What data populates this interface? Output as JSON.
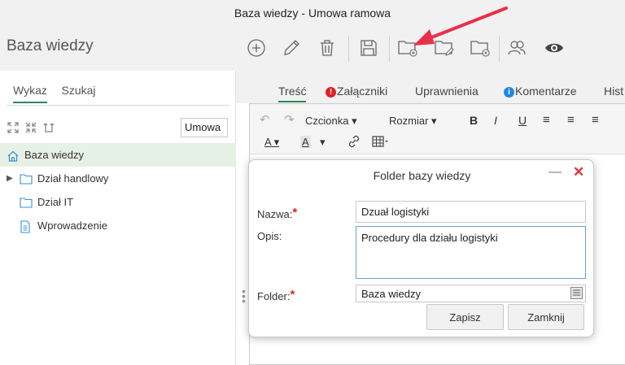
{
  "window": {
    "title": "Baza wiedzy - Umowa ramowa"
  },
  "sidebar": {
    "title": "Baza wiedzy",
    "tabs": [
      "Wykaz",
      "Szukaj"
    ],
    "filter_value": "Umowa",
    "tree": [
      {
        "label": "Baza wiedzy"
      },
      {
        "label": "Dział handlowy"
      },
      {
        "label": "Dział IT"
      },
      {
        "label": "Wprowadzenie"
      }
    ]
  },
  "toolbar": {
    "icons": [
      "add-icon",
      "edit-icon",
      "delete-icon",
      "save-icon",
      "new-folder-icon",
      "edit-folder-icon",
      "delete-folder-icon",
      "users-icon",
      "preview-icon"
    ],
    "annotation_arrow_color": "#e8304a"
  },
  "content_tabs": [
    "Treść",
    "Załączniki",
    "Uprawnienia",
    "Komentarze",
    "Hist"
  ],
  "editor_toolbar": {
    "font_label": "Czcionka",
    "size_label": "Rozmiar"
  },
  "dialog": {
    "title": "Folder bazy wiedzy",
    "name_label": "Nazwa:",
    "name_value": "Dzuał logistyki",
    "desc_label": "Opis:",
    "desc_value": "Procedury dla działu logistyki",
    "folder_label": "Folder:",
    "folder_value": "Baza wiedzy",
    "save_label": "Zapisz",
    "close_label": "Zamknij"
  },
  "colors": {
    "accent": "#2d8a57",
    "selected_row": "#e5f1e4",
    "required": "#e02020",
    "alert_red": "#e02020",
    "info_blue": "#1e88e5"
  }
}
